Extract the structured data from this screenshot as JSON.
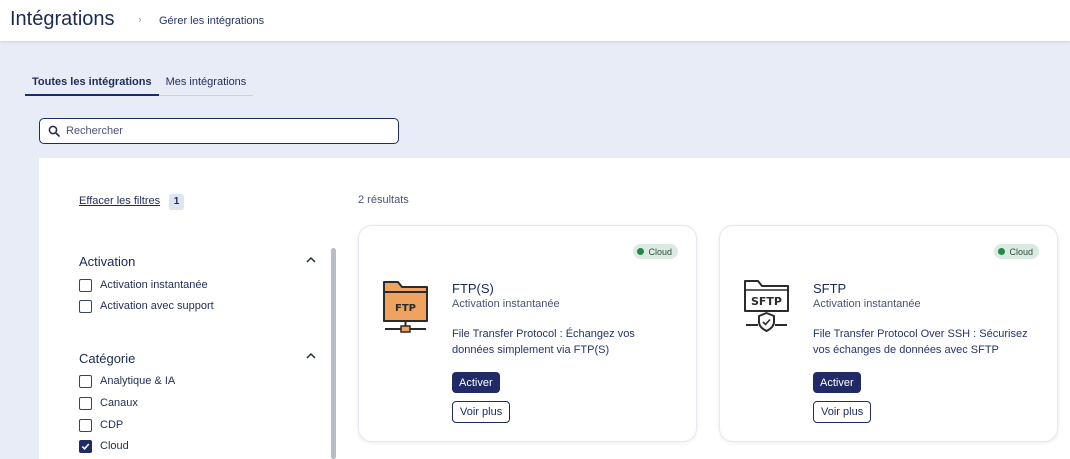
{
  "header": {
    "title": "Intégrations",
    "breadcrumb_separator": "›",
    "breadcrumb": "Gérer les intégrations"
  },
  "tabs": [
    {
      "label": "Toutes les intégrations",
      "active": true
    },
    {
      "label": "Mes intégrations",
      "active": false
    }
  ],
  "search": {
    "placeholder": "Rechercher",
    "value": ""
  },
  "filters": {
    "clear_label": "Effacer les filtres",
    "active_count": "1",
    "groups": [
      {
        "title": "Activation",
        "expanded": true,
        "options": [
          {
            "label": "Activation instantanée",
            "checked": false
          },
          {
            "label": "Activation avec support",
            "checked": false
          }
        ]
      },
      {
        "title": "Catégorie",
        "expanded": true,
        "options": [
          {
            "label": "Analytique & IA",
            "checked": false
          },
          {
            "label": "Canaux",
            "checked": false
          },
          {
            "label": "CDP",
            "checked": false
          },
          {
            "label": "Cloud",
            "checked": true
          }
        ]
      }
    ]
  },
  "results": {
    "count_label": "2 résultats",
    "cards": [
      {
        "name": "FTP(S)",
        "badge": "Cloud",
        "activation": "Activation instantanée",
        "description": "File Transfer Protocol : Échangez vos données simplement via FTP(S)",
        "logo_text": "FTP",
        "logo_icon": "ftp-folder-icon",
        "primary_label": "Activer",
        "secondary_label": "Voir plus"
      },
      {
        "name": "SFTP",
        "badge": "Cloud",
        "activation": "Activation instantanée",
        "description": "File Transfer Protocol Over SSH : Sécurisez vos échanges de données avec SFTP",
        "logo_text": "SFTP",
        "logo_icon": "sftp-folder-shield-icon",
        "primary_label": "Activer",
        "secondary_label": "Voir plus"
      }
    ]
  },
  "colors": {
    "primary": "#1f2a66",
    "page_bg": "#e7ecf6",
    "badge_bg": "#dcebe2",
    "badge_dot": "#1f8a45",
    "ftp_folder": "#f0a35e"
  }
}
